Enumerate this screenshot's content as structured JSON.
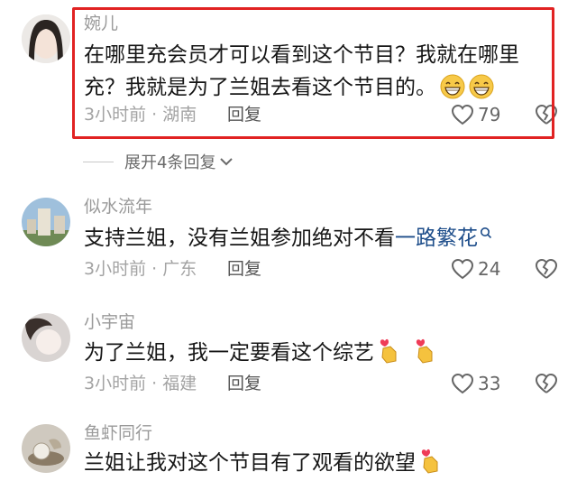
{
  "comments": [
    {
      "username": "婉儿",
      "text": "在哪里充会员才可以看到这个节目？我就在哪里充？我就是为了兰姐去看这个节目的。",
      "emoji": "grin-emoji",
      "time_location": "3小时前 · 湖南",
      "reply_label": "回复",
      "likes": "79"
    },
    {
      "username": "似水流年",
      "text": "支持兰姐，没有兰姐参加绝对不看",
      "link_text": "一路繁花",
      "time_location": "3小时前 · 广东",
      "reply_label": "回复",
      "likes": "24"
    },
    {
      "username": "小宇宙",
      "text": "为了兰姐，我一定要看这个综艺",
      "emoji": "finger-heart-emoji",
      "time_location": "3小时前 · 福建",
      "reply_label": "回复",
      "likes": "33"
    },
    {
      "username": "鱼虾同行",
      "text": "兰姐让我对这个节目有了观看的欲望",
      "emoji": "finger-heart-emoji"
    }
  ],
  "expand_replies": {
    "label": "展开4条回复"
  },
  "colors": {
    "highlight": "#e12222",
    "link": "#1d4d8a"
  }
}
